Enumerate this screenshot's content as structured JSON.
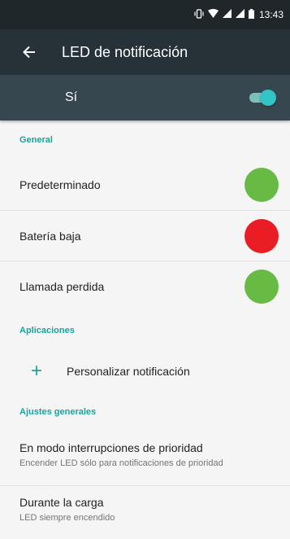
{
  "status_bar": {
    "time": "13:43",
    "icons": [
      "vibrate-icon",
      "wifi-icon",
      "signal-icon",
      "signal-icon",
      "battery-icon"
    ]
  },
  "toolbar": {
    "back_icon": "arrow-back-icon",
    "title": "LED de notificación"
  },
  "master_switch": {
    "label": "Sí",
    "checked": true,
    "color": "#33c5c5"
  },
  "sections": {
    "general": {
      "header": "General",
      "items": [
        {
          "label": "Predeterminado",
          "color": "#67bb44"
        },
        {
          "label": "Batería baja",
          "color": "#ea1c24"
        },
        {
          "label": "Llamada perdida",
          "color": "#67bb44"
        }
      ]
    },
    "apps": {
      "header": "Aplicaciones",
      "add_label": "Personalizar notificación"
    },
    "general_settings": {
      "header": "Ajustes generales",
      "items": [
        {
          "title": "En modo interrupciones de prioridad",
          "summary": "Encender LED sólo para notificaciones de prioridad"
        },
        {
          "title": "Durante la carga",
          "summary": "LED siempre encendido"
        }
      ]
    }
  },
  "theme": {
    "accent": "#1aa39b",
    "toolbar": "#263238",
    "master_bar": "#37474f"
  }
}
